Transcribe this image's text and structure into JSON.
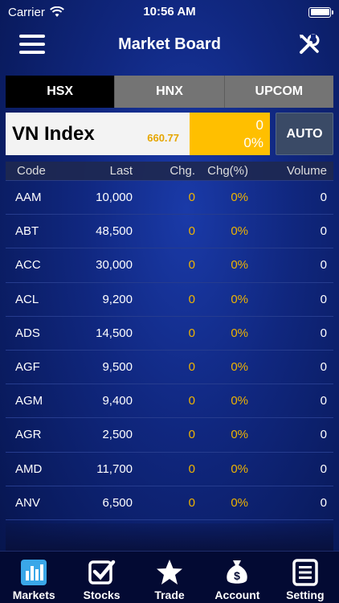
{
  "status_bar": {
    "carrier": "Carrier",
    "time": "10:56 AM"
  },
  "nav": {
    "title": "Market Board"
  },
  "exchange_tabs": [
    {
      "label": "HSX",
      "active": true
    },
    {
      "label": "HNX",
      "active": false
    },
    {
      "label": "UPCOM",
      "active": false
    }
  ],
  "index": {
    "name": "VN Index",
    "value": "660.77",
    "change": "0",
    "change_pct": "0%",
    "auto_label": "AUTO"
  },
  "table": {
    "headers": {
      "code": "Code",
      "last": "Last",
      "chg": "Chg.",
      "chg_pct": "Chg(%)",
      "volume": "Volume"
    },
    "rows": [
      {
        "code": "AAM",
        "last": "10,000",
        "chg": "0",
        "chg_pct": "0%",
        "volume": "0"
      },
      {
        "code": "ABT",
        "last": "48,500",
        "chg": "0",
        "chg_pct": "0%",
        "volume": "0"
      },
      {
        "code": "ACC",
        "last": "30,000",
        "chg": "0",
        "chg_pct": "0%",
        "volume": "0"
      },
      {
        "code": "ACL",
        "last": "9,200",
        "chg": "0",
        "chg_pct": "0%",
        "volume": "0"
      },
      {
        "code": "ADS",
        "last": "14,500",
        "chg": "0",
        "chg_pct": "0%",
        "volume": "0"
      },
      {
        "code": "AGF",
        "last": "9,500",
        "chg": "0",
        "chg_pct": "0%",
        "volume": "0"
      },
      {
        "code": "AGM",
        "last": "9,400",
        "chg": "0",
        "chg_pct": "0%",
        "volume": "0"
      },
      {
        "code": "AGR",
        "last": "2,500",
        "chg": "0",
        "chg_pct": "0%",
        "volume": "0"
      },
      {
        "code": "AMD",
        "last": "11,700",
        "chg": "0",
        "chg_pct": "0%",
        "volume": "0"
      },
      {
        "code": "ANV",
        "last": "6,500",
        "chg": "0",
        "chg_pct": "0%",
        "volume": "0"
      }
    ]
  },
  "tab_bar": [
    {
      "label": "Markets",
      "icon": "bar-chart-icon",
      "active": true
    },
    {
      "label": "Stocks",
      "icon": "checkbox-icon",
      "active": false
    },
    {
      "label": "Trade",
      "icon": "star-icon",
      "active": false
    },
    {
      "label": "Account",
      "icon": "money-bag-icon",
      "active": false
    },
    {
      "label": "Setting",
      "icon": "list-icon",
      "active": false
    }
  ],
  "colors": {
    "accent_yellow": "#ffbf00",
    "active_tab_icon": "#3aa7e8",
    "background": "#10277f"
  }
}
